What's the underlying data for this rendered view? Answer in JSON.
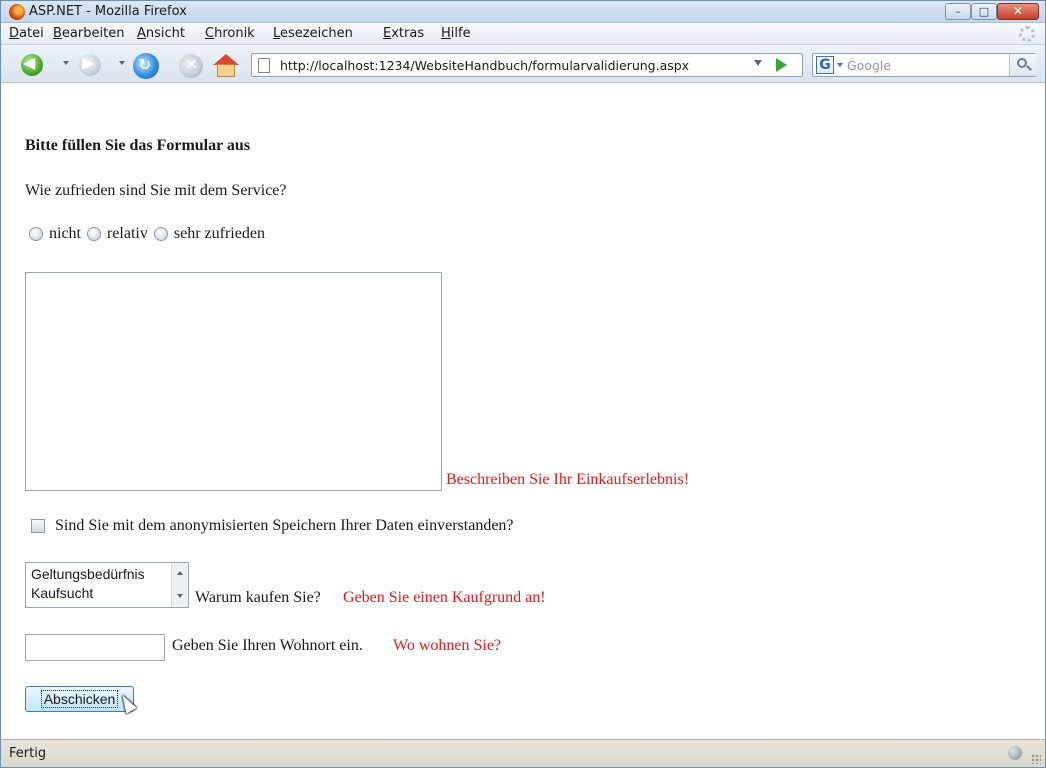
{
  "window": {
    "title": "ASP.NET - Mozilla Firefox",
    "controls": {
      "minimize": "–",
      "maximize": "□",
      "close": "✕"
    }
  },
  "menu": {
    "items": [
      {
        "label": "Datei",
        "accel": "D",
        "rest": "atei"
      },
      {
        "label": "Bearbeiten",
        "accel": "B",
        "rest": "earbeiten"
      },
      {
        "label": "Ansicht",
        "accel": "A",
        "rest": "nsicht"
      },
      {
        "label": "Chronik",
        "accel": "C",
        "rest": "hronik"
      },
      {
        "label": "Lesezeichen",
        "accel": "L",
        "rest": "esezeichen"
      },
      {
        "label": "Extras",
        "accel": "E",
        "rest": "xtras"
      },
      {
        "label": "Hilfe",
        "accel": "H",
        "rest": "ilfe"
      }
    ]
  },
  "navigation": {
    "back_glyph": "◀",
    "forward_glyph": "▶",
    "reload_glyph": "↻",
    "stop_glyph": "✕",
    "url": "http://localhost:1234/WebsiteHandbuch/formularvalidierung.aspx",
    "search_engine_letter": "G",
    "search_placeholder": "Google"
  },
  "form": {
    "heading": "Bitte füllen Sie das Formular aus",
    "question": "Wie zufrieden sind Sie mit dem Service?",
    "radio_options": [
      "nicht",
      "relativ",
      "sehr zufrieden"
    ],
    "comment_value": "",
    "comment_error": "Beschreiben Sie Ihr Einkaufserlebnis!",
    "consent_label": "Sind Sie mit dem anonymisierten Speichern Ihrer Daten einverstanden?",
    "reason_options": [
      "Geltungsbedürfnis",
      "Kaufsucht"
    ],
    "reason_label": "Warum kaufen Sie?",
    "reason_error": "Geben Sie einen Kaufgrund an!",
    "city_value": "",
    "city_label": "Geben Sie Ihren Wohnort ein.",
    "city_error": "Wo wohnen Sie?",
    "submit_label": "Abschicken"
  },
  "status": {
    "text": "Fertig"
  },
  "colors": {
    "error": "#e21a1a",
    "chrome": "#dce8f5"
  }
}
